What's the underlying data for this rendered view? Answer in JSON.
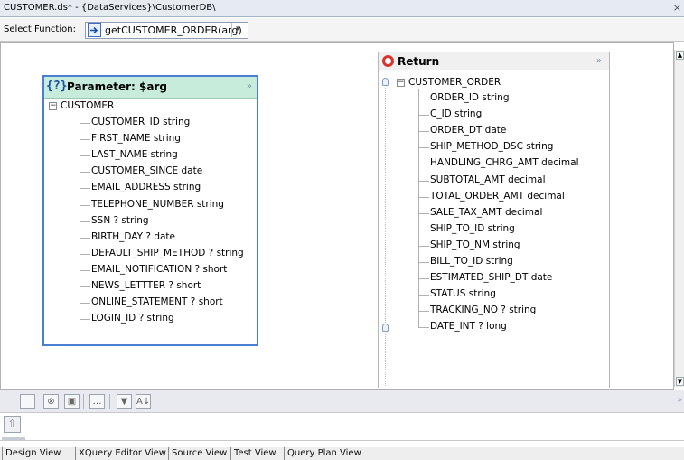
{
  "window": {
    "title": "CUSTOMER.ds* - {DataServices}\\CustomerDB\\",
    "close_glyph": "×"
  },
  "function_bar": {
    "label": "Select Function:",
    "selected_function": "getCUSTOMER_ORDER(arg)",
    "function_icon": "function-icon",
    "dropdown_glyph": "▾"
  },
  "parameter_panel": {
    "title": "Parameter: $arg",
    "icon_text": "{?}",
    "collapse_glyph": "»",
    "root": "CUSTOMER",
    "expander_glyph": "−",
    "fields": [
      "CUSTOMER_ID string",
      "FIRST_NAME string",
      "LAST_NAME string",
      "CUSTOMER_SINCE date",
      "EMAIL_ADDRESS string",
      "TELEPHONE_NUMBER string",
      "SSN ? string",
      "BIRTH_DAY ? date",
      "DEFAULT_SHIP_METHOD ? string",
      "EMAIL_NOTIFICATION ? short",
      "NEWS_LETTTER ? short",
      "ONLINE_STATEMENT ? short",
      "LOGIN_ID ? string"
    ]
  },
  "return_panel": {
    "title": "Return",
    "collapse_glyph": "»",
    "root": "CUSTOMER_ORDER",
    "expander_glyph": "−",
    "fields": [
      "ORDER_ID string",
      "C_ID string",
      "ORDER_DT date",
      "SHIP_METHOD_DSC string",
      "HANDLING_CHRG_AMT decimal",
      "SUBTOTAL_AMT decimal",
      "TOTAL_ORDER_AMT decimal",
      "SALE_TAX_AMT decimal",
      "SHIP_TO_ID string",
      "SHIP_TO_NM string",
      "BILL_TO_ID string",
      "ESTIMATED_SHIP_DT date",
      "STATUS string",
      "TRACKING_NO ? string",
      "DATE_INT ? long"
    ]
  },
  "scrollbar": {
    "up_glyph": "▲",
    "down_glyph": "▼"
  },
  "bottom_toolbar": {
    "buttons": [
      {
        "name": "blank-button",
        "glyph": ""
      },
      {
        "name": "error-filter-icon",
        "glyph": "⊗"
      },
      {
        "name": "warning-filter-icon",
        "glyph": "▣"
      },
      {
        "name": "more-options-button",
        "glyph": "…"
      },
      {
        "name": "filter-icon",
        "glyph": "▼"
      },
      {
        "name": "sort-az-icon",
        "glyph": "A↓"
      }
    ],
    "more_glyph": "»"
  },
  "lower_panel": {
    "up_glyph": "⇧"
  },
  "tabs": [
    "Design View",
    "XQuery Editor View",
    "Source View",
    "Test View",
    "Query Plan View"
  ],
  "colors": {
    "param_header_bg": "#c8ecdc",
    "param_border": "#4a7fce",
    "return_icon": "#d9342b"
  }
}
